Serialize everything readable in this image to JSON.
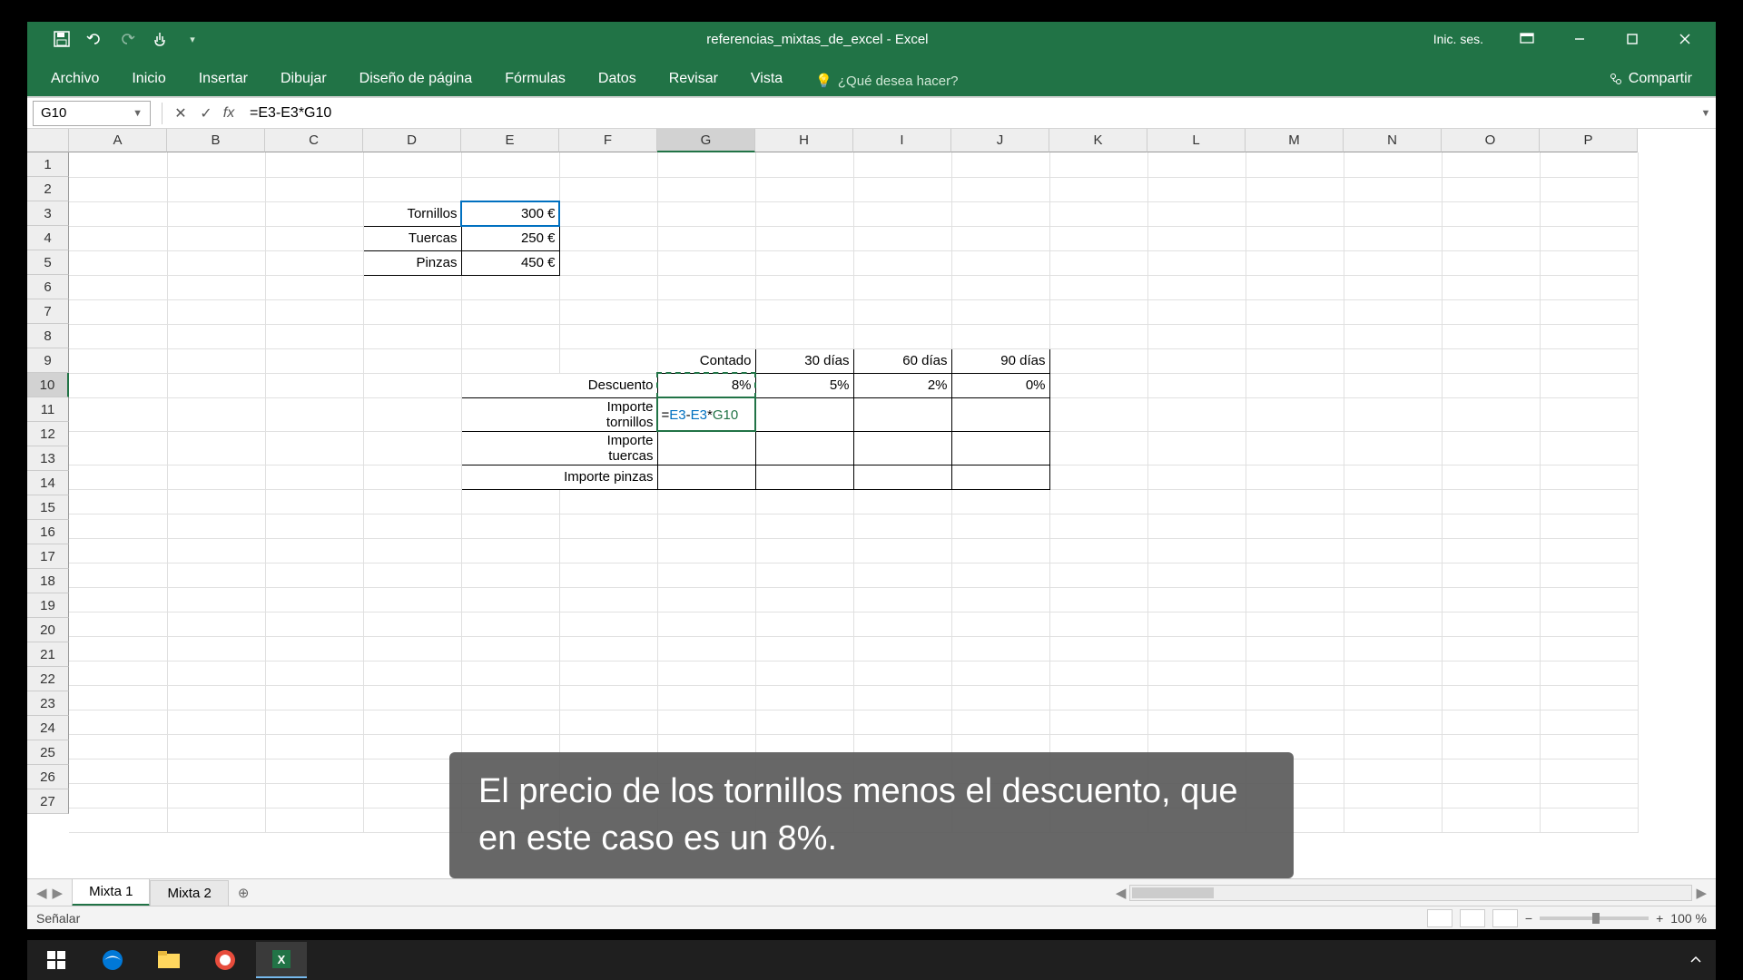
{
  "app": {
    "title": "referencias_mixtas_de_excel - Excel",
    "signin": "Inic. ses."
  },
  "ribbon": {
    "tabs": [
      "Archivo",
      "Inicio",
      "Insertar",
      "Dibujar",
      "Diseño de página",
      "Fórmulas",
      "Datos",
      "Revisar",
      "Vista"
    ],
    "tell_me": "¿Qué desea hacer?",
    "share": "Compartir"
  },
  "formula_bar": {
    "name_box": "G10",
    "formula": "=E3-E3*G10"
  },
  "columns": [
    "A",
    "B",
    "C",
    "D",
    "E",
    "F",
    "G",
    "H",
    "I",
    "J",
    "K",
    "L",
    "M",
    "N",
    "O",
    "P"
  ],
  "selected_col_index": 6,
  "selected_row_index": 10,
  "row_count": 27,
  "table1": {
    "rows": [
      {
        "label": "Tornillos",
        "value": "300 €"
      },
      {
        "label": "Tuercas",
        "value": "250 €"
      },
      {
        "label": "Pinzas",
        "value": "450 €"
      }
    ]
  },
  "table2": {
    "headers": [
      "Contado",
      "30 días",
      "60 días",
      "90 días"
    ],
    "rows": [
      {
        "label": "Descuento",
        "values": [
          "8%",
          "5%",
          "2%",
          "0%"
        ]
      },
      {
        "label": "Importe tornillos",
        "values": [
          "=E3-E3*G10",
          "",
          "",
          ""
        ]
      },
      {
        "label": "Importe tuercas",
        "values": [
          "",
          "",
          "",
          ""
        ]
      },
      {
        "label": "Importe pinzas",
        "values": [
          "",
          "",
          "",
          ""
        ]
      }
    ]
  },
  "edit_cell_parts": {
    "eq": "=",
    "r1": "E3",
    "op1": "-",
    "r2": "E3",
    "op2": "*",
    "r3": "G10"
  },
  "sheets": {
    "tabs": [
      "Mixta 1",
      "Mixta 2"
    ],
    "active": 0
  },
  "status": {
    "mode": "Señalar",
    "zoom": "100 %"
  },
  "subtitle": "El precio de los tornillos menos el descuento, que en este caso es un 8%.",
  "colors": {
    "excel_green": "#217346",
    "ref_blue": "#0070c0"
  }
}
